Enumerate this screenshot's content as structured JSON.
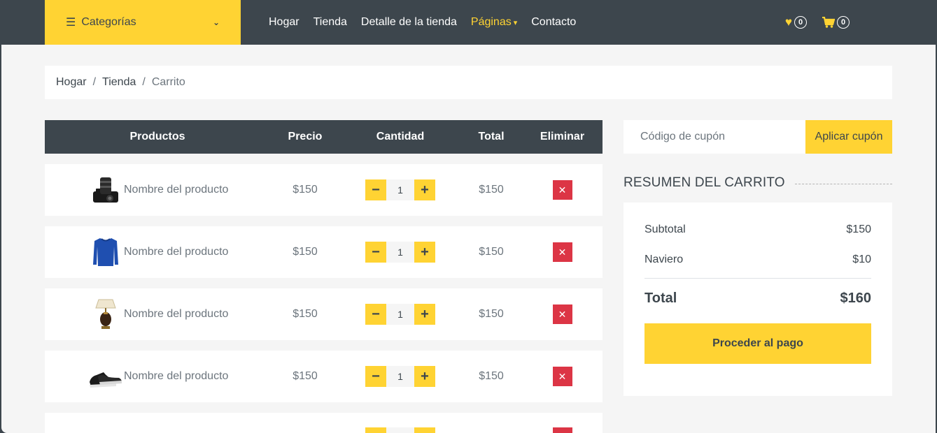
{
  "navbar": {
    "categories_label": "Categorías",
    "links": [
      "Hogar",
      "Tienda",
      "Detalle de la tienda",
      "Páginas",
      "Contacto"
    ],
    "active_link": "Páginas",
    "wishlist_count": "0",
    "cart_count": "0"
  },
  "breadcrumb": [
    "Hogar",
    "Tienda",
    "Carrito"
  ],
  "cart": {
    "headers": [
      "Productos",
      "Precio",
      "Cantidad",
      "Total",
      "Eliminar"
    ],
    "rows": [
      {
        "image": "camera",
        "name": "Nombre del producto",
        "price": "$150",
        "quantity": "1",
        "total": "$150"
      },
      {
        "image": "sweater",
        "name": "Nombre del producto",
        "price": "$150",
        "quantity": "1",
        "total": "$150"
      },
      {
        "image": "lamp",
        "name": "Nombre del producto",
        "price": "$150",
        "quantity": "1",
        "total": "$150"
      },
      {
        "image": "shoes",
        "name": "Nombre del producto",
        "price": "$150",
        "quantity": "1",
        "total": "$150"
      }
    ]
  },
  "coupon": {
    "placeholder": "Código de cupón",
    "button_label": "Aplicar cupón"
  },
  "summary": {
    "title": "RESUMEN DEL CARRITO",
    "subtotal_label": "Subtotal",
    "subtotal_value": "$150",
    "shipping_label": "Naviero",
    "shipping_value": "$10",
    "total_label": "Total",
    "total_value": "$160",
    "checkout_label": "Proceder al pago"
  },
  "colors": {
    "accent": "#ffd333",
    "dark": "#3d464d",
    "danger": "#dc3545",
    "background": "#f5f5f5"
  }
}
